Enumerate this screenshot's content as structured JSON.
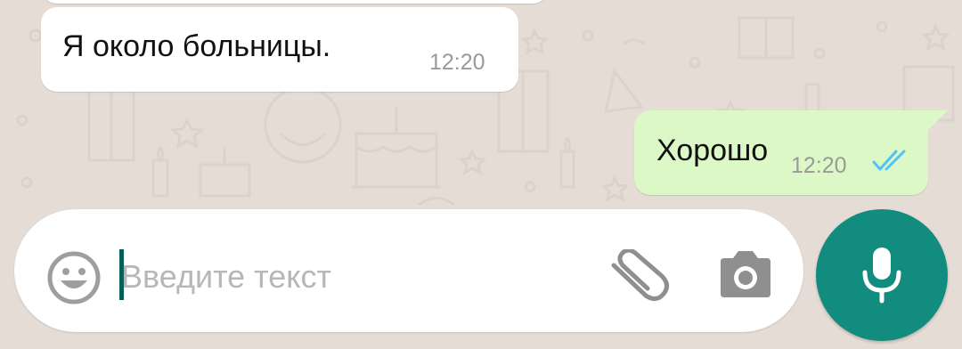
{
  "chat": {
    "messages": [
      {
        "direction": "incoming",
        "text": "Я около больницы.",
        "time": "12:20"
      },
      {
        "direction": "outgoing",
        "text": "Хорошо",
        "time": "12:20",
        "status": "read",
        "status_icon": "double-check-icon"
      }
    ]
  },
  "composer": {
    "placeholder": "Введите текст",
    "emoji_icon": "emoji-icon",
    "attach_icon": "paperclip-icon",
    "camera_icon": "camera-icon",
    "send_button_icon": "microphone-icon"
  },
  "colors": {
    "wallpaper": "#e5ddd5",
    "incoming_bubble": "#ffffff",
    "outgoing_bubble": "#dcf8c6",
    "accent": "#128c7e",
    "read_ticks": "#4fc3f7"
  }
}
